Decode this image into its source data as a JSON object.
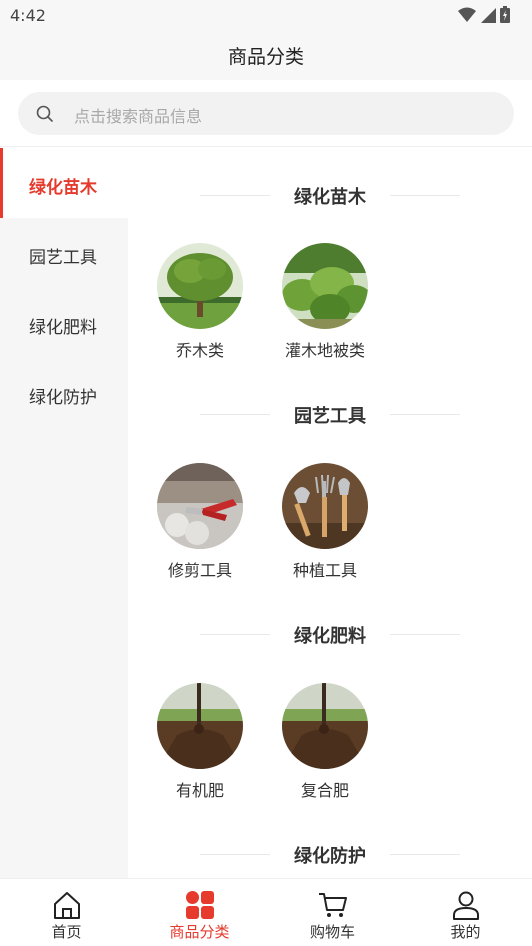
{
  "status_bar": {
    "time": "4:42"
  },
  "header": {
    "title": "商品分类"
  },
  "search": {
    "placeholder": "点击搜索商品信息"
  },
  "sidebar": {
    "items": [
      {
        "label": "绿化苗木",
        "active": true
      },
      {
        "label": "园艺工具",
        "active": false
      },
      {
        "label": "绿化肥料",
        "active": false
      },
      {
        "label": "绿化防护",
        "active": false
      }
    ]
  },
  "content": {
    "sections": [
      {
        "title": "绿化苗木",
        "items": [
          {
            "name": "乔木类",
            "icon": "tree-photo"
          },
          {
            "name": "灌木地被类",
            "icon": "shrub-photo"
          }
        ]
      },
      {
        "title": "园艺工具",
        "items": [
          {
            "name": "修剪工具",
            "icon": "pruning-shears-photo"
          },
          {
            "name": "种植工具",
            "icon": "garden-tools-photo"
          }
        ]
      },
      {
        "title": "绿化肥料",
        "items": [
          {
            "name": "有机肥",
            "icon": "soil-photo"
          },
          {
            "name": "复合肥",
            "icon": "soil-photo"
          }
        ]
      },
      {
        "title": "绿化防护",
        "items": []
      }
    ]
  },
  "tabbar": {
    "items": [
      {
        "label": "首页",
        "icon": "home-icon",
        "active": false
      },
      {
        "label": "商品分类",
        "icon": "category-icon",
        "active": true
      },
      {
        "label": "购物车",
        "icon": "cart-icon",
        "active": false
      },
      {
        "label": "我的",
        "icon": "user-icon",
        "active": false
      }
    ]
  },
  "colors": {
    "accent": "#e53a2c",
    "sidebar_bg": "#f6f6f6"
  }
}
